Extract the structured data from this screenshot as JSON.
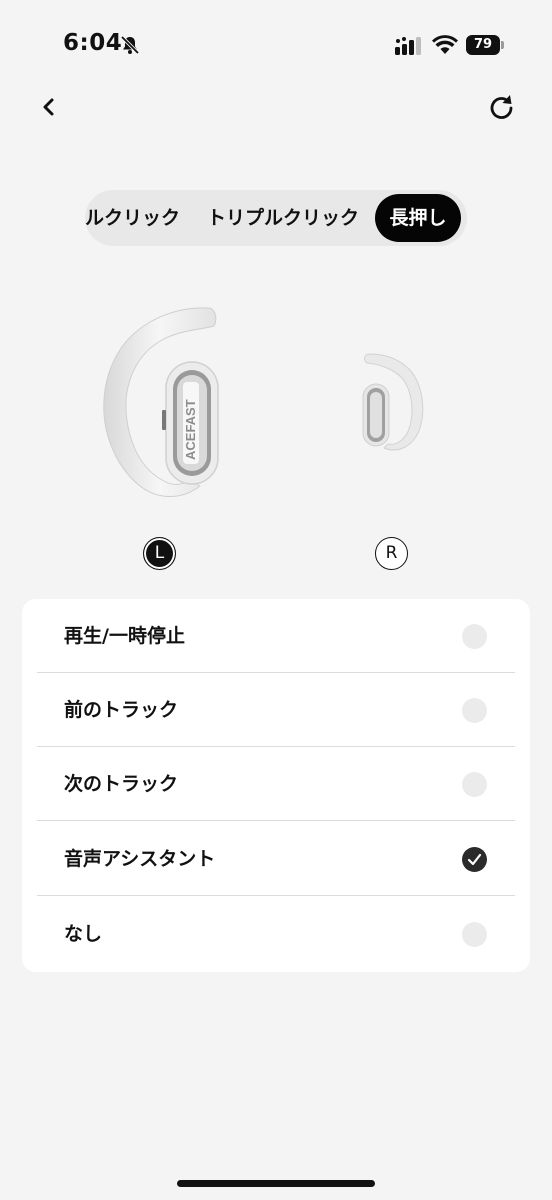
{
  "status_bar": {
    "time": "6:04",
    "battery_level": "79",
    "icons": [
      "bell-slash-icon",
      "signal-icon",
      "wifi-icon",
      "battery-icon"
    ]
  },
  "nav": {
    "back_icon": "chevron-left-icon",
    "refresh_icon": "refresh-icon"
  },
  "tabs": [
    {
      "label": "ダブルクリック",
      "visible_text": "ルクリック",
      "selected": false
    },
    {
      "label": "トリプルクリック",
      "visible_text": "トリプルクリック",
      "selected": false
    },
    {
      "label": "長押し",
      "visible_text": "長押し",
      "selected": true
    }
  ],
  "earbuds": {
    "left_brand": "ACEFAST",
    "left_label": "L",
    "right_label": "R",
    "selected_side": "L"
  },
  "options": [
    {
      "label": "再生/一時停止",
      "checked": false
    },
    {
      "label": "前のトラック",
      "checked": false
    },
    {
      "label": "次のトラック",
      "checked": false
    },
    {
      "label": "音声アシスタント",
      "checked": true
    },
    {
      "label": "なし",
      "checked": false
    }
  ],
  "colors": {
    "background": "#f4f4f4",
    "card": "#ffffff",
    "accent": "#050505",
    "radio_empty": "#ebebeb",
    "radio_checked": "#2b2b2b"
  }
}
